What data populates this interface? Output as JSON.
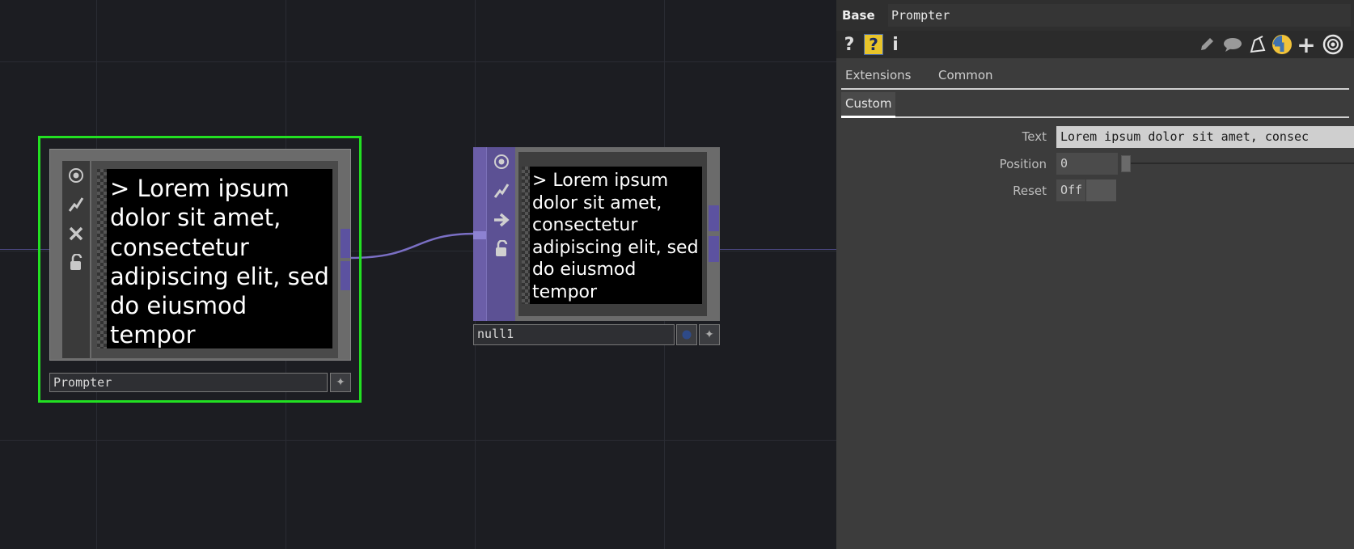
{
  "network": {
    "prompter_node": {
      "name": "Prompter",
      "viewer_text": "> Lorem ipsum dolor sit amet, consectetur adipiscing elit, sed do eiusmod tempor",
      "flags": [
        "viewer-icon",
        "cook-icon",
        "bypass-icon",
        "lock-icon"
      ]
    },
    "null_node": {
      "name": "null1",
      "viewer_text": "> Lorem ipsum dolor sit amet, consectetur adipiscing elit, sed do eiusmod tempor",
      "flags": [
        "viewer-icon",
        "cook-icon",
        "arrow-icon",
        "lock-icon"
      ]
    },
    "colors": {
      "background": "#1c1d22",
      "selection": "#22e022",
      "wire": "#7a6fc4",
      "null_accent": "#6b5ea8"
    }
  },
  "panel": {
    "op_type": "Base",
    "op_name": "Prompter",
    "toolbar_icons": [
      "help-icon",
      "python-help-icon",
      "info-icon",
      "edit-icon",
      "comment-icon",
      "clone-icon",
      "python-icon",
      "add-icon",
      "viewer-icon"
    ],
    "toolbar_help": "?",
    "toolbar_info": "i",
    "toolbar_add": "+",
    "tabs_row1": [
      "Extensions",
      "Common"
    ],
    "tabs_row2": [
      "Custom"
    ],
    "params": {
      "text_label": "Text",
      "text_value": "Lorem ipsum dolor sit amet, consec",
      "position_label": "Position",
      "position_value": "0",
      "reset_label": "Reset",
      "reset_value": "Off"
    }
  }
}
